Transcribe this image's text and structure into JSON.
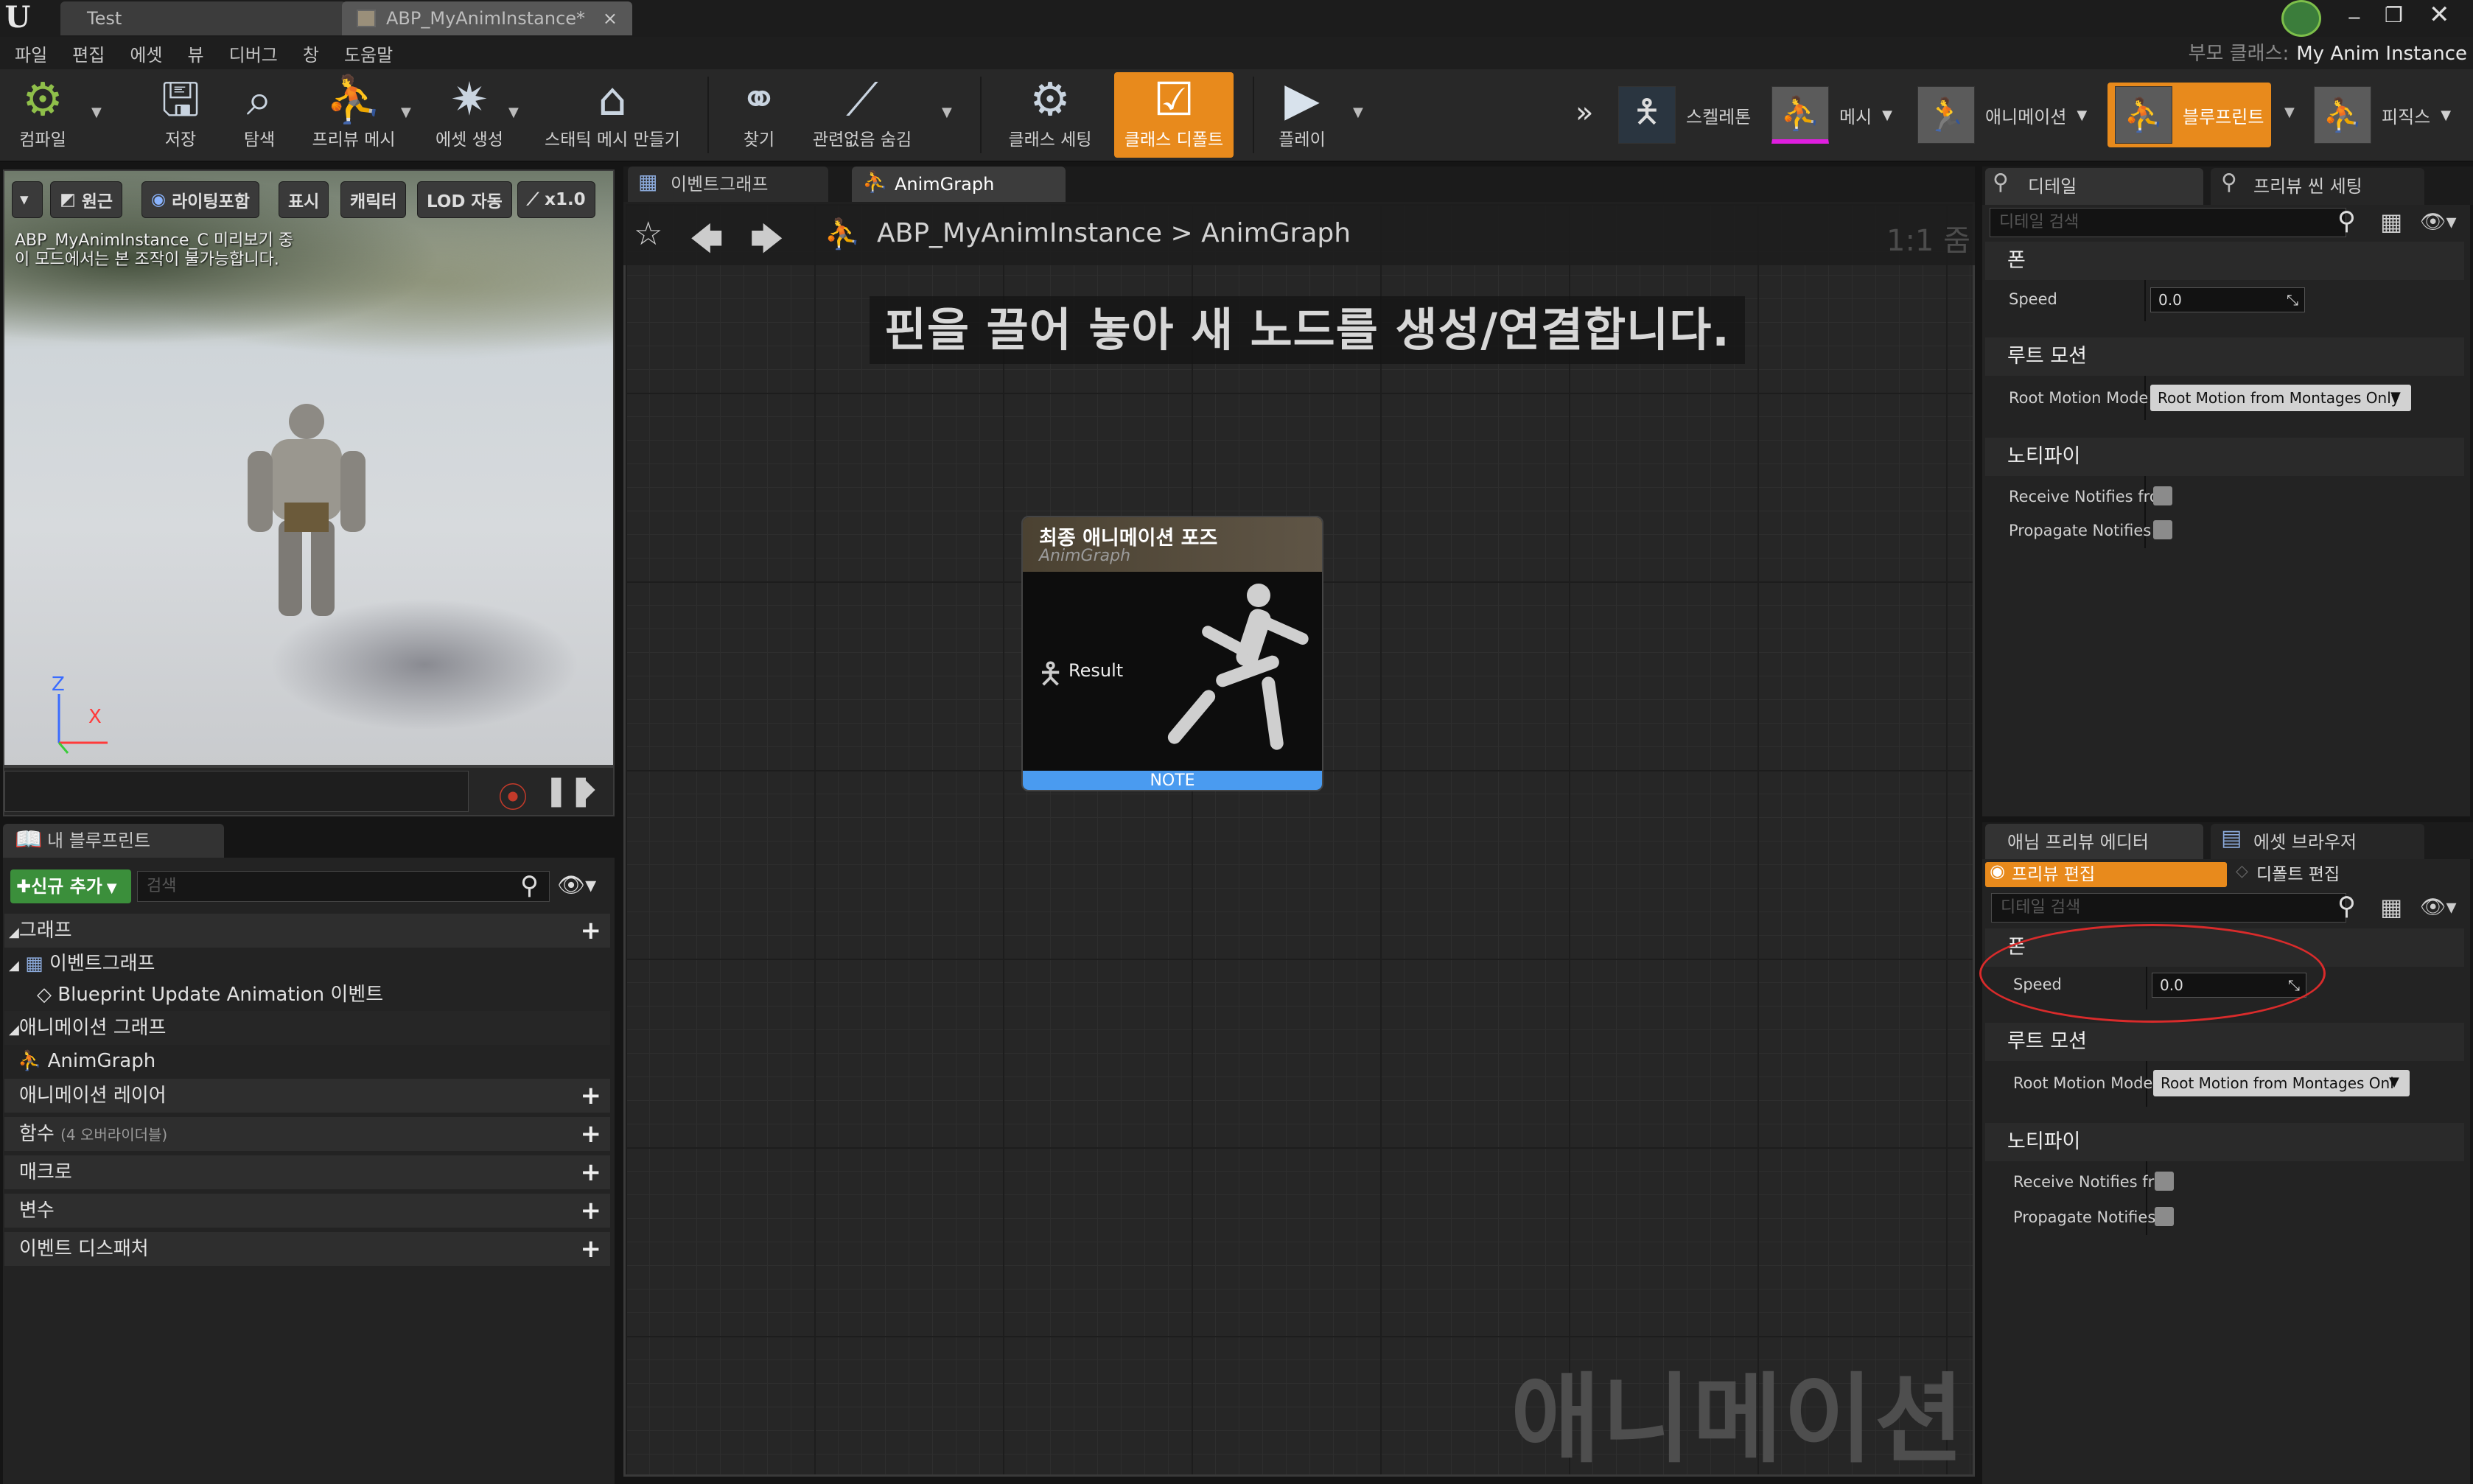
{
  "window": {
    "tabs": [
      "Test",
      "ABP_MyAnimInstance*"
    ],
    "parent_class_label": "부모 클래스:",
    "parent_class_value": "My Anim Instance"
  },
  "menu": [
    "파일",
    "편집",
    "에셋",
    "뷰",
    "디버그",
    "창",
    "도움말"
  ],
  "toolbar": {
    "buttons": [
      "컴파일",
      "저장",
      "탐색",
      "프리뷰 메시",
      "에셋 생성",
      "스태틱 메시 만들기",
      "찾기",
      "관련없음 숨김",
      "클래스 세팅",
      "클래스 디폴트",
      "플레이"
    ],
    "modes": [
      "스켈레톤",
      "메시",
      "애니메이션",
      "블루프린트",
      "피직스"
    ],
    "active_button": "클래스 디폴트",
    "active_mode": "블루프린트",
    "accent_color": "#e88a1c"
  },
  "viewport": {
    "buttons": [
      "원근",
      "라이팅포함",
      "표시",
      "캐릭터",
      "LOD 자동",
      "x1.0"
    ],
    "info_line1": "ABP_MyAnimInstance_C 미리보기 중",
    "info_line2": "이 모드에서는 본 조작이 불가능합니다.",
    "axis_z": "Z",
    "axis_x": "X"
  },
  "my_blueprint": {
    "tab": "내 블루프린트",
    "add_new": "신규 추가",
    "search_placeholder": "검색",
    "graph_section": "그래프",
    "event_graph": "이벤트그래프",
    "update_event": "Blueprint Update Animation 이벤트",
    "anim_graph_section": "애니메이션 그래프",
    "anim_graph": "AnimGraph",
    "layers": "애니메이션 레이어",
    "functions": "함수",
    "functions_note": "(4 오버라이더블)",
    "macros": "매크로",
    "variables": "변수",
    "dispatchers": "이벤트 디스패처"
  },
  "graph": {
    "tabs": [
      "이벤트그래프",
      "AnimGraph"
    ],
    "breadcrumb_asset": "ABP_MyAnimInstance",
    "breadcrumb_sep": ">",
    "breadcrumb_graph": "AnimGraph",
    "zoom": "1:1 줌",
    "hint": "핀을 끌어 놓아 새 노드를 생성/연결합니다.",
    "watermark": "애니메이션",
    "node": {
      "title": "최종 애니메이션 포즈",
      "subtitle": "AnimGraph",
      "pin": "Result",
      "footer": "NOTE"
    }
  },
  "details": {
    "tabs": [
      "디테일",
      "프리뷰 씬 세팅"
    ],
    "search_placeholder": "디테일 검색",
    "sections": {
      "pawn": "폰",
      "root_motion": "루트 모션",
      "notify": "노티파이"
    },
    "speed_label": "Speed",
    "speed_value": "0.0",
    "root_motion_label": "Root Motion Mode",
    "root_motion_value": "Root Motion from Montages Only",
    "receive_notifies": "Receive Notifies fron",
    "propagate_notifies": "Propagate Notifies t"
  },
  "preview_editor": {
    "tabs": [
      "애님 프리뷰 에디터",
      "에셋 브라우저"
    ],
    "subtabs": [
      "프리뷰 편집",
      "디폴트 편집"
    ],
    "search_placeholder": "디테일 검색",
    "sections": {
      "pawn": "폰",
      "root_motion": "루트 모션",
      "notify": "노티파이"
    },
    "speed_label": "Speed",
    "speed_value": "0.0",
    "root_motion_label": "Root Motion Mode",
    "root_motion_value": "Root Motion from Montages Onl",
    "receive_notifies": "Receive Notifies fro",
    "propagate_notifies": "Propagate Notifies"
  },
  "annotation_color": "#d92b2b"
}
